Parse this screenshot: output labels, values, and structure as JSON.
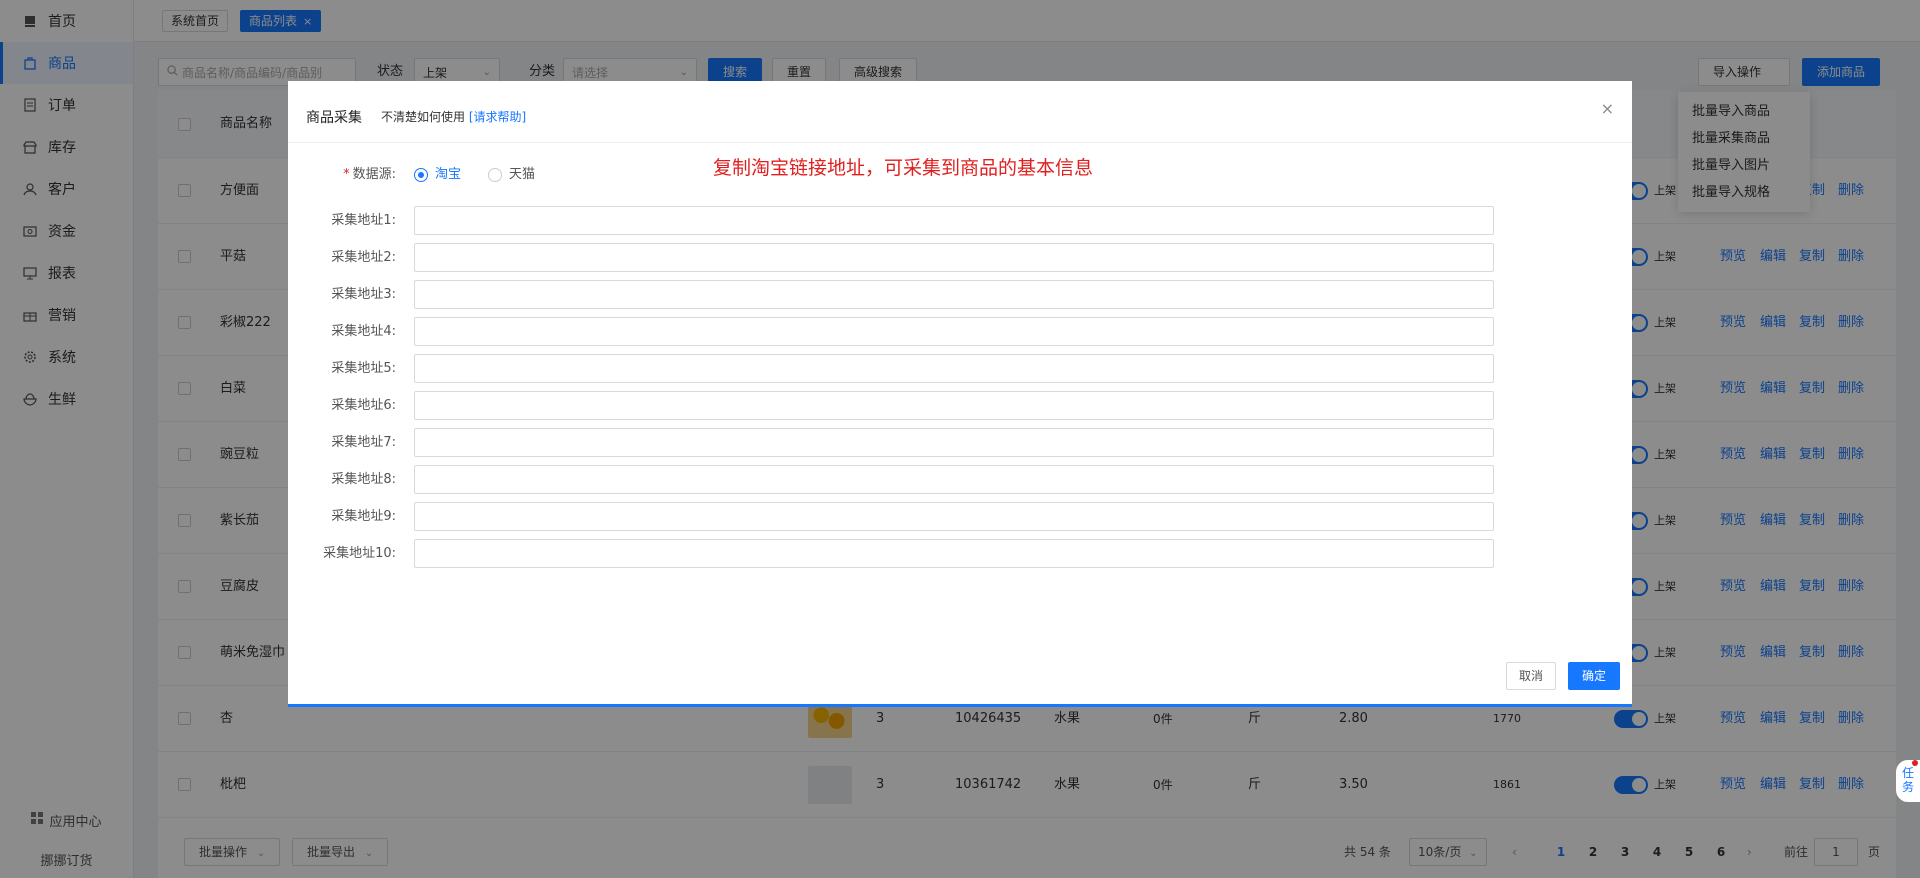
{
  "sidebar": {
    "items": [
      {
        "label": "首页",
        "icon": "home-icon"
      },
      {
        "label": "商品",
        "icon": "bag-icon",
        "active": true
      },
      {
        "label": "订单",
        "icon": "order-icon"
      },
      {
        "label": "库存",
        "icon": "store-icon"
      },
      {
        "label": "客户",
        "icon": "user-icon"
      },
      {
        "label": "资金",
        "icon": "wallet-icon"
      },
      {
        "label": "报表",
        "icon": "report-icon"
      },
      {
        "label": "营销",
        "icon": "gift-icon"
      },
      {
        "label": "系统",
        "icon": "gear-icon"
      },
      {
        "label": "生鲜",
        "icon": "bowl-icon"
      }
    ],
    "app_center": "应用中心",
    "brand": "挪挪订货"
  },
  "tabs": [
    {
      "label": "系统首页"
    },
    {
      "label": "商品列表",
      "close": "×",
      "active": true
    }
  ],
  "filters": {
    "search_placeholder": "商品名称/商品编码/商品别",
    "status_label": "状态",
    "status_value": "上架",
    "category_label": "分类",
    "category_placeholder": "请选择",
    "search_btn": "搜索",
    "reset_btn": "重置",
    "advanced_btn": "高级搜索",
    "import_btn": "导入操作",
    "add_btn": "添加商品"
  },
  "import_menu": [
    "批量导入商品",
    "批量采集商品",
    "批量导入图片",
    "批量导入规格"
  ],
  "table": {
    "header_name": "商品名称",
    "rows": [
      {
        "name": "方便面"
      },
      {
        "name": "平菇"
      },
      {
        "name": "彩椒222"
      },
      {
        "name": "白菜"
      },
      {
        "name": "豌豆粒"
      },
      {
        "name": "紫长茄"
      },
      {
        "name": "豆腐皮"
      },
      {
        "name": "萌米免湿巾"
      },
      {
        "name": "杏",
        "qty": "3",
        "code": "10426435",
        "category": "水果",
        "stock": "0件",
        "unit": "斤",
        "price": "2.80",
        "sales": "1770"
      },
      {
        "name": "枇杷",
        "qty": "3",
        "code": "10361742",
        "category": "水果",
        "stock": "0件",
        "unit": "斤",
        "price": "3.50",
        "sales": "1861"
      }
    ],
    "status_text": "上架",
    "actions": [
      "预览",
      "编辑",
      "复制",
      "删除"
    ]
  },
  "pager": {
    "batch_op": "批量操作",
    "batch_export": "批量导出",
    "total": "共 54 条",
    "page_size": "10条/页",
    "prev": "‹",
    "next": "›",
    "pages": [
      "1",
      "2",
      "3",
      "4",
      "5",
      "6"
    ],
    "goto_label": "前往",
    "goto_value": "1",
    "page_unit": "页"
  },
  "modal": {
    "title": "商品采集",
    "help_text": "不清楚如何使用",
    "help_link": "[请求帮助]",
    "close": "×",
    "note": "复制淘宝链接地址，可采集到商品的基本信息",
    "source_label": "数据源:",
    "source_required": "*",
    "sources": [
      "淘宝",
      "天猫"
    ],
    "fields": [
      "采集地址1:",
      "采集地址2:",
      "采集地址3:",
      "采集地址4:",
      "采集地址5:",
      "采集地址6:",
      "采集地址7:",
      "采集地址8:",
      "采集地址9:",
      "采集地址10:"
    ],
    "cancel": "取消",
    "confirm": "确定"
  },
  "task_float": "任务"
}
